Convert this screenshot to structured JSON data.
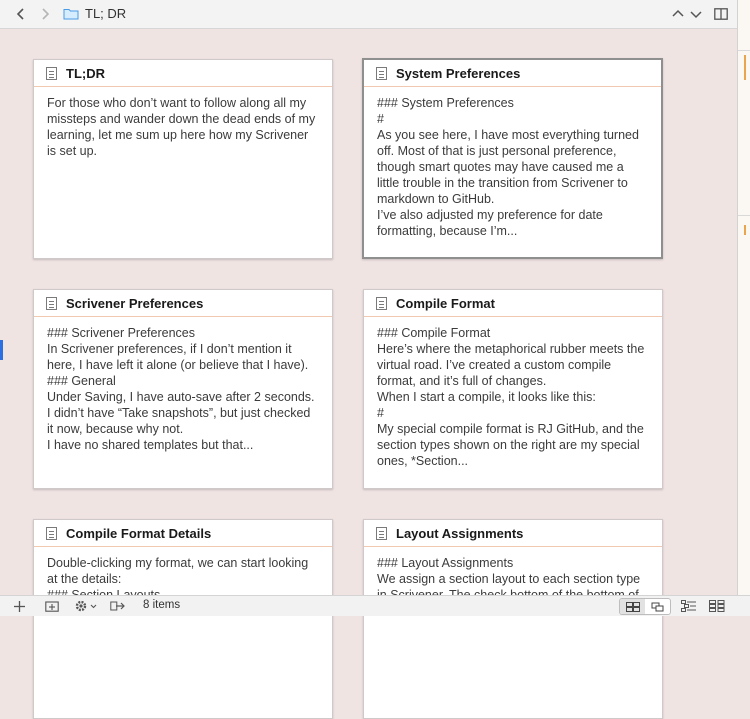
{
  "header": {
    "back_label": "‹",
    "forward_label": "›",
    "title": "TL; DR",
    "up_label": "⌃",
    "down_label": "⌄"
  },
  "cards": [
    {
      "title": "TL;DR",
      "body": "For those who don’t want to follow along all my missteps and wander down the dead ends of my learning, let me sum up here how my Scrivener is set up."
    },
    {
      "title": "System Preferences",
      "body": "### System Preferences\n#\nAs you see here, I have most everything turned off. Most of that is just personal preference, though smart quotes may have caused me a little trouble in the transition from Scrivener to markdown to GitHub.\nI’ve also adjusted my preference for date formatting, because I’m..."
    },
    {
      "title": "Scrivener Preferences",
      "body": "### Scrivener Preferences\nIn Scrivener preferences, if I don’t mention it here, I have left it alone (or believe that I have).\n### General\nUnder Saving, I have auto-save after 2 seconds. I didn’t have “Take snapshots”, but just checked it now, because why not.\nI have no shared templates but that..."
    },
    {
      "title": "Compile Format",
      "body": "### Compile Format\nHere’s where the metaphorical rubber meets the virtual road. I’ve created a custom compile format, and it’s full of changes.\nWhen I start a compile, it looks like this:\n#\nMy special compile format is RJ GitHub, and the section types shown on the right are my special ones, *Section..."
    },
    {
      "title": "Compile Format Details",
      "body": "Double-clicking my format, we can start looking at the details:\n### Section Layouts"
    },
    {
      "title": "Layout Assignments",
      "body": "### Layout Assignments\nWe assign a section layout to each section type in Scrivener. The check bottom of the bottom of"
    }
  ],
  "footer": {
    "items_count": "8 items"
  }
}
